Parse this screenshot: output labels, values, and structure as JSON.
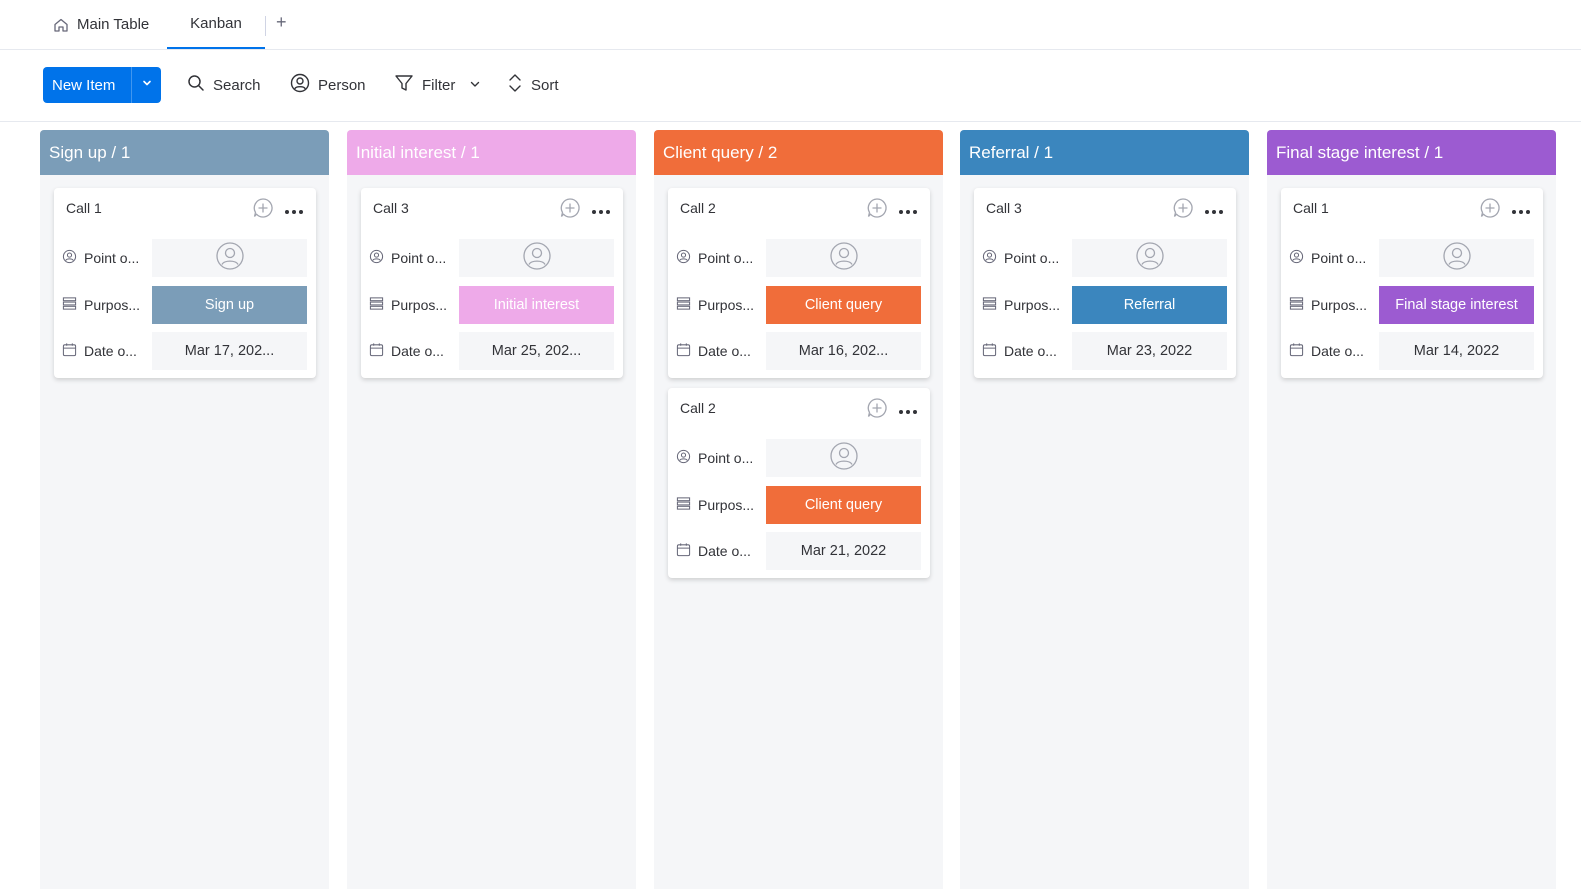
{
  "tabs": {
    "main_table": "Main Table",
    "kanban": "Kanban",
    "add": "+"
  },
  "toolbar": {
    "new_item": "New Item",
    "search": "Search",
    "person": "Person",
    "filter": "Filter",
    "sort": "Sort"
  },
  "labels": {
    "point_of_contact": "Point o...",
    "purpose": "Purpos...",
    "date": "Date o..."
  },
  "columns": [
    {
      "title": "Sign up / 1",
      "color": "#7b9db8",
      "status_color": "#7b9db8",
      "cards": [
        {
          "name": "Call 1",
          "purpose": "Sign up",
          "date": "Mar 17, 202..."
        }
      ]
    },
    {
      "title": "Initial interest / 1",
      "color": "#eeaae9",
      "status_color": "#eeaae9",
      "cards": [
        {
          "name": "Call 3",
          "purpose": "Initial interest",
          "date": "Mar 25, 202..."
        }
      ]
    },
    {
      "title": "Client query / 2",
      "color": "#f06d3a",
      "status_color": "#f06d3a",
      "cards": [
        {
          "name": "Call 2",
          "purpose": "Client query",
          "date": "Mar 16, 202..."
        },
        {
          "name": "Call 2",
          "purpose": "Client query",
          "date": "Mar 21, 2022"
        }
      ]
    },
    {
      "title": "Referral / 1",
      "color": "#3b86be",
      "status_color": "#3b86be",
      "cards": [
        {
          "name": "Call 3",
          "purpose": "Referral",
          "date": "Mar 23, 2022"
        }
      ]
    },
    {
      "title": "Final stage interest / 1",
      "color": "#9c5bd1",
      "status_color": "#9c5bd1",
      "cards": [
        {
          "name": "Call 1",
          "purpose": "Final stage interest",
          "date": "Mar 14, 2022"
        }
      ]
    }
  ]
}
